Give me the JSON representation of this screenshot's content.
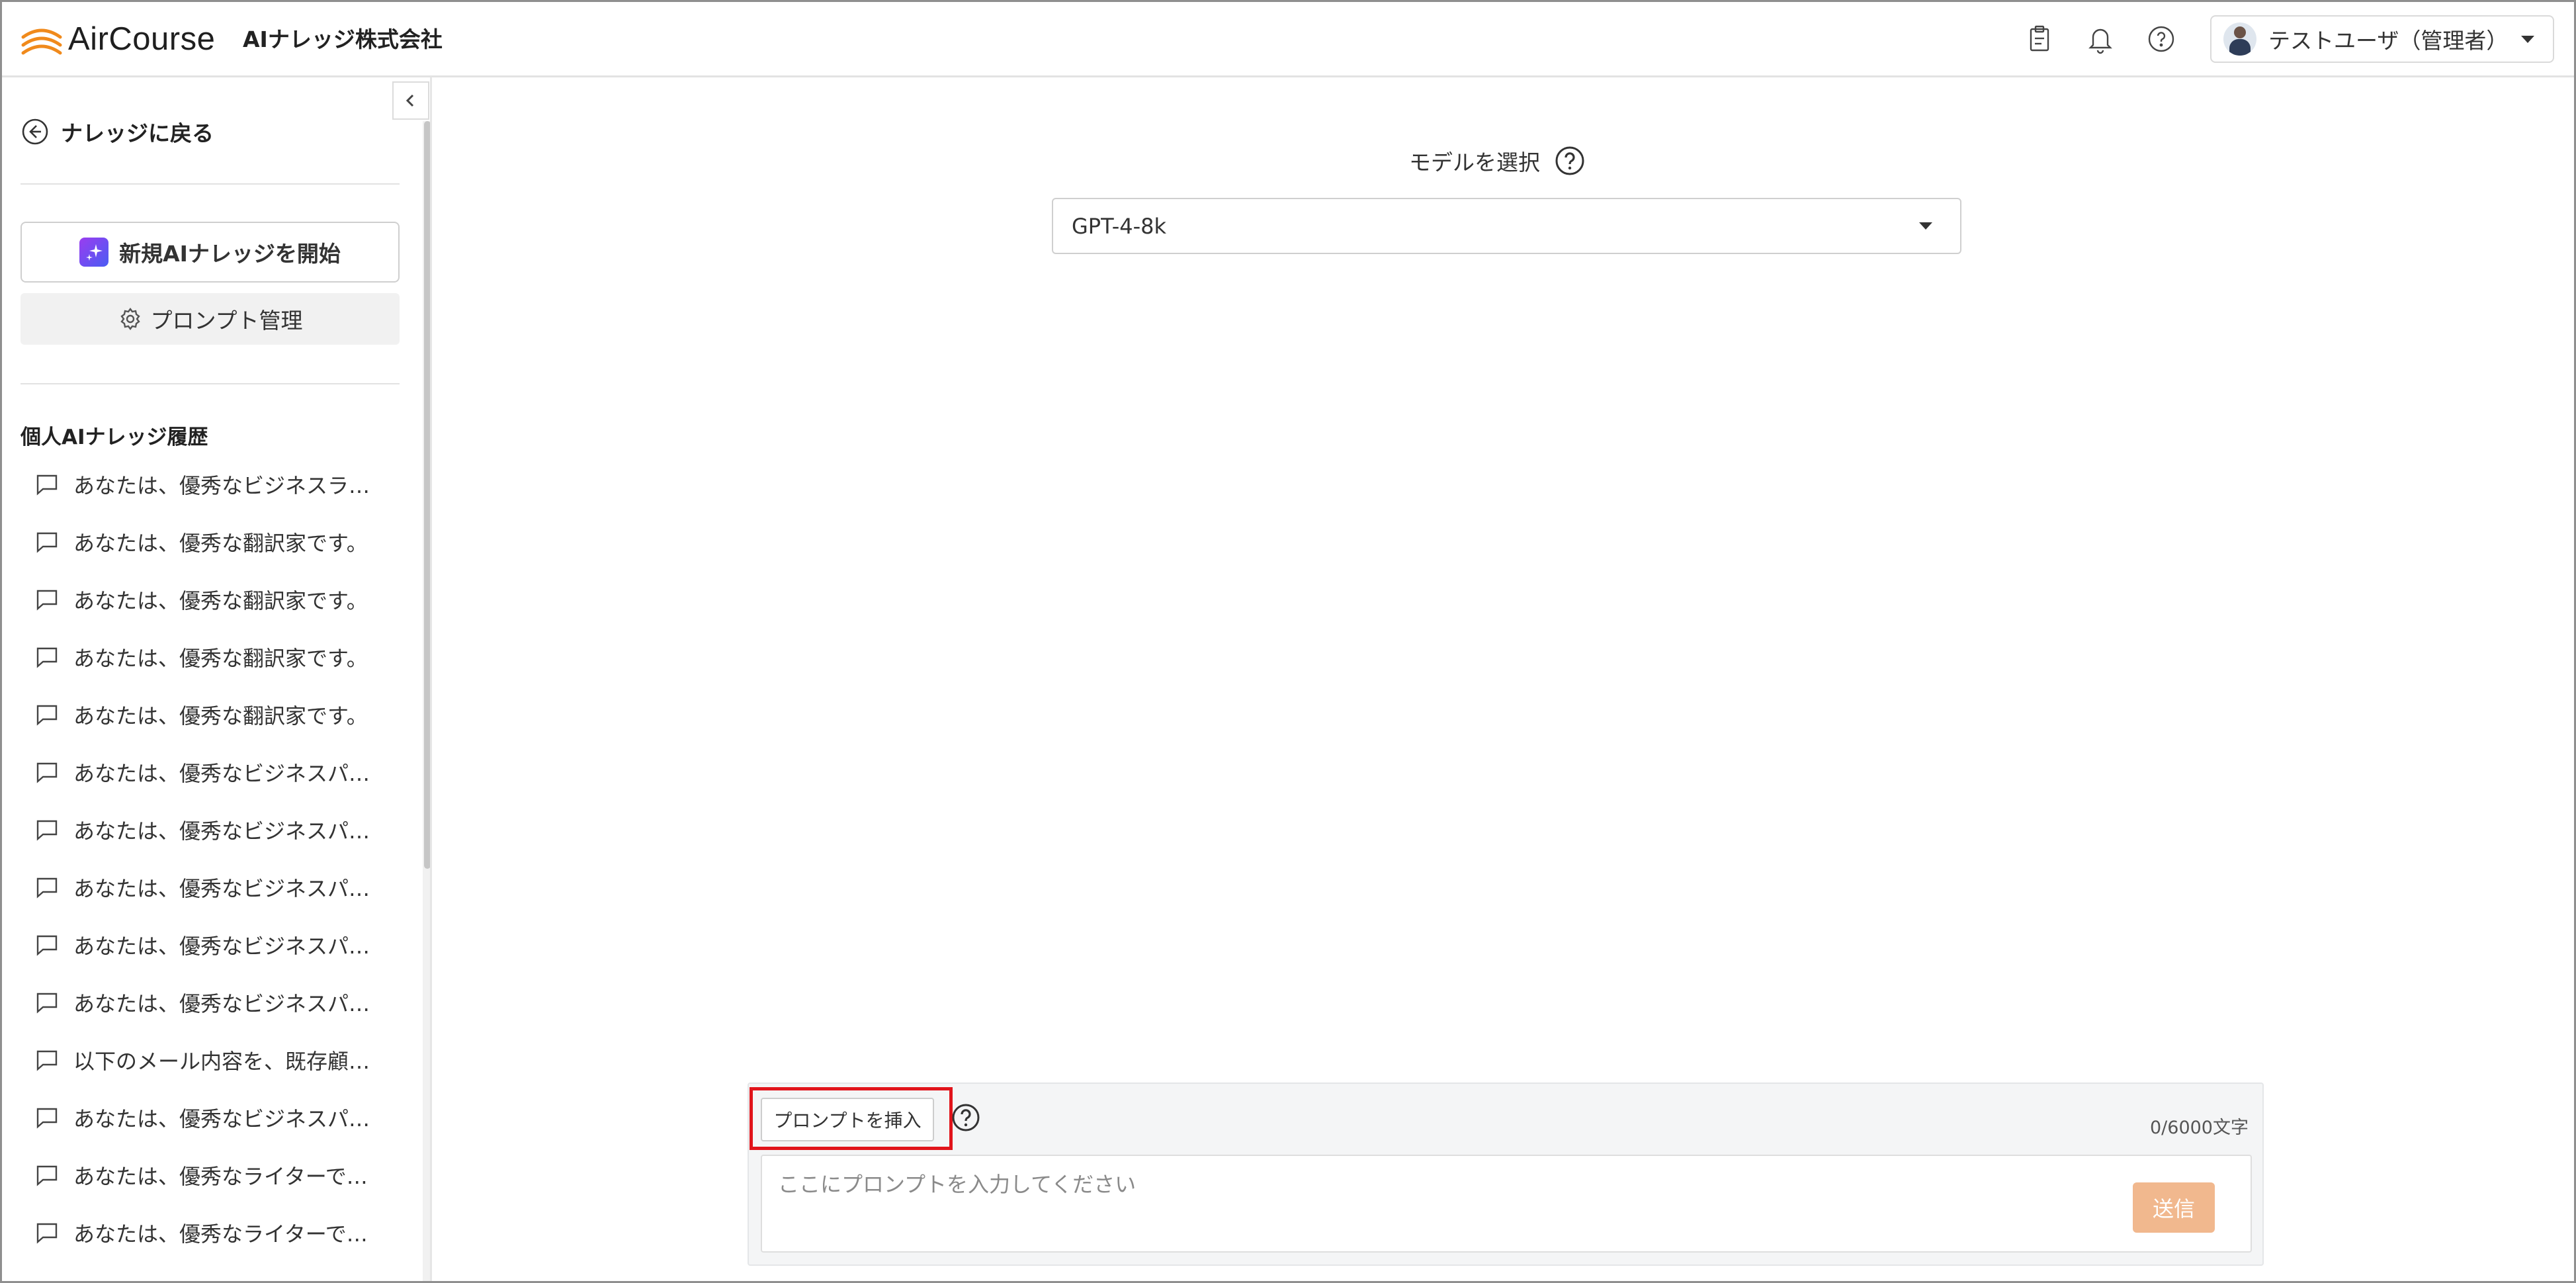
{
  "header": {
    "app_name": "AirCourse",
    "company": "AIナレッジ株式会社",
    "icons": [
      "clipboard-icon",
      "bell-icon",
      "help-icon"
    ],
    "user_name": "テストユーザ（管理者）",
    "brand_color": "#f08a1c"
  },
  "sidebar": {
    "back_label": "ナレッジに戻る",
    "new_button_label": "新規AIナレッジを開始",
    "prompt_manage_label": "プロンプト管理",
    "history_title": "個人AIナレッジ履歴",
    "history": [
      "あなたは、優秀なビジネスラ…",
      "あなたは、優秀な翻訳家です。",
      "あなたは、優秀な翻訳家です。",
      "あなたは、優秀な翻訳家です。",
      "あなたは、優秀な翻訳家です。",
      "あなたは、優秀なビジネスパ…",
      "あなたは、優秀なビジネスパ…",
      "あなたは、優秀なビジネスパ…",
      "あなたは、優秀なビジネスパ…",
      "あなたは、優秀なビジネスパ…",
      "以下のメール内容を、既存顧…",
      "あなたは、優秀なビジネスパ…",
      "あなたは、優秀なライターで…",
      "あなたは、優秀なライターで…"
    ]
  },
  "main": {
    "model_label": "モデルを選択",
    "model_value": "GPT-4-8k"
  },
  "composer": {
    "insert_label": "プロンプトを挿入",
    "counter": "0/6000文字",
    "placeholder": "ここにプロンプトを入力してください",
    "send_label": "送信",
    "send_color": "#f1b88e",
    "highlight_color": "#e1141b"
  }
}
